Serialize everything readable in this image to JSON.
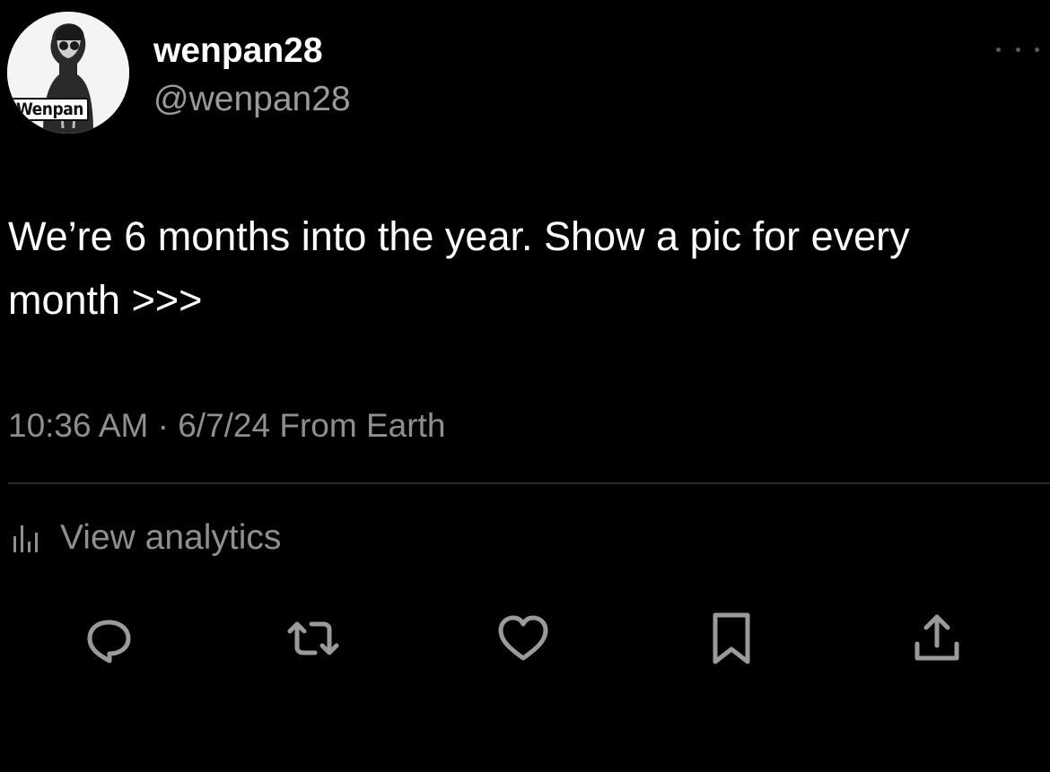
{
  "author": {
    "display_name": "wenpan28",
    "handle": "@wenpan28",
    "avatar_tag": "Wenpan"
  },
  "tweet": {
    "text": "We’re 6 months into the year. Show a pic for every month >>>",
    "meta": "10:36 AM · 6/7/24 From Earth"
  },
  "analytics": {
    "label": "View analytics",
    "icon": "bar-chart-icon"
  },
  "actions": [
    {
      "name": "reply",
      "icon": "reply-icon"
    },
    {
      "name": "retweet",
      "icon": "retweet-icon"
    },
    {
      "name": "like",
      "icon": "heart-icon"
    },
    {
      "name": "bookmark",
      "icon": "bookmark-icon"
    },
    {
      "name": "share",
      "icon": "share-icon"
    }
  ],
  "colors": {
    "background": "#000000",
    "text_primary": "#ffffff",
    "text_secondary": "#8f8f8f",
    "divider": "#2b2b2b",
    "icon": "#9a9a9a"
  }
}
